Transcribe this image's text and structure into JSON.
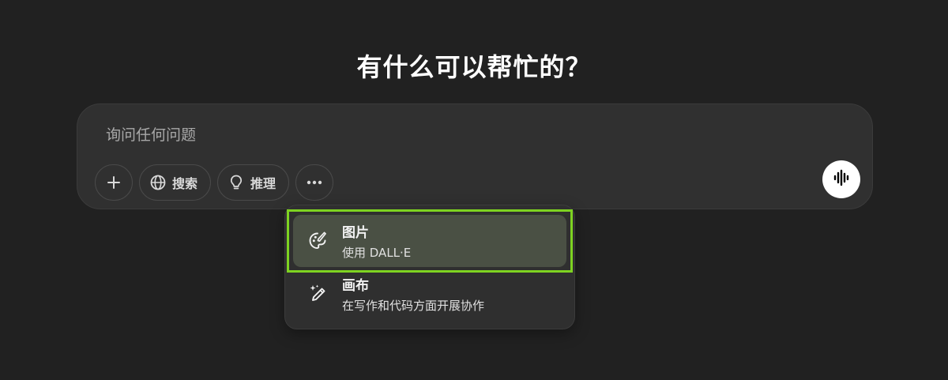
{
  "heading": "有什么可以帮忙的？",
  "composer": {
    "placeholder": "询问任何问题",
    "tools": {
      "add_icon": "plus-icon",
      "search_label": "搜索",
      "search_icon": "globe-icon",
      "reason_label": "推理",
      "reason_icon": "lightbulb-icon",
      "more_icon": "ellipsis-icon"
    },
    "voice_icon": "voice-waveform-icon"
  },
  "menu": {
    "items": [
      {
        "title": "图片",
        "subtitle": "使用 DALL·E",
        "icon": "palette-icon",
        "highlighted": true
      },
      {
        "title": "画布",
        "subtitle": "在写作和代码方面开展协作",
        "icon": "pencil-sparkle-icon",
        "highlighted": false
      }
    ]
  },
  "colors": {
    "background": "#212121",
    "composer": "#303030",
    "highlight_outline": "#7ed321",
    "active_item": "#4a5044"
  }
}
